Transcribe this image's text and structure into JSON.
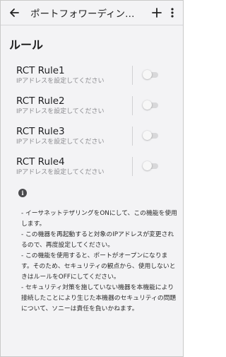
{
  "appbar": {
    "title": "ポートフォワーディン…",
    "back_icon": "arrow-left-icon",
    "add_icon": "plus-icon",
    "more_icon": "more-vert-icon"
  },
  "section": {
    "title": "ルール"
  },
  "rules": [
    {
      "name": "RCT Rule1",
      "sub": "IPアドレスを設定してください",
      "enabled": false
    },
    {
      "name": "RCT Rule2",
      "sub": "IPアドレスを設定してください",
      "enabled": false
    },
    {
      "name": "RCT Rule3",
      "sub": "IPアドレスを設定してください",
      "enabled": false
    },
    {
      "name": "RCT Rule4",
      "sub": "IPアドレスを設定してください",
      "enabled": false
    }
  ],
  "info": {
    "icon": "info-icon",
    "notes": [
      "- イーサネットテザリングをONにして、この機能を使用します。",
      "- この機器を再起動すると対象のIPアドレスが変更されるので、再度設定してください。",
      "- この機能を使用すると、ポートがオープンになります。そのため、セキュリティの観点から、使用しないときはルールをOFFにしてください。",
      "- セキュリティ対策を施していない機器を本機能により接続したことにより生じた本機器のセキュリティの問題について、ソニーは責任を負いかねます。"
    ]
  },
  "colors": {
    "background": "#f3f3f5",
    "text": "#202124",
    "subtext": "#8a8a8e",
    "toggle_track": "#d8d8da"
  }
}
